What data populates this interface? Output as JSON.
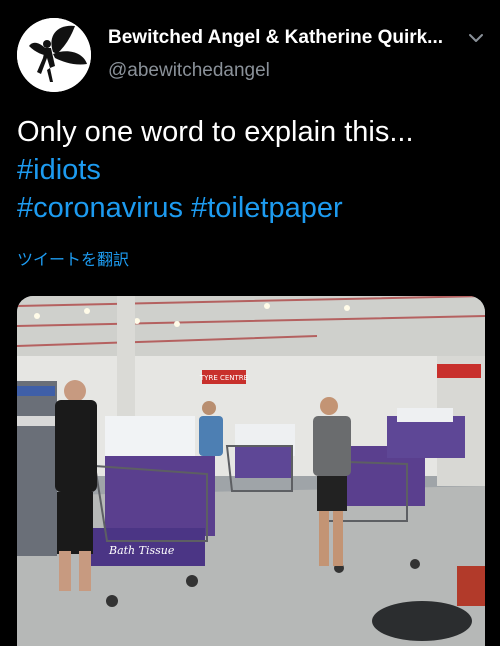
{
  "author": {
    "display_name": "Bewitched Angel & Katherine Quirk...",
    "handle": "@abewitchedangel",
    "avatar_icon": "fairy-silhouette-avatar"
  },
  "menu": {
    "icon": "chevron-down-icon"
  },
  "tweet": {
    "text_line1": "Only one word to explain this...",
    "hashtags": [
      "#idiots",
      "#coronavirus",
      "#toiletpaper"
    ]
  },
  "translate_label": "ツイートを翻訳",
  "media": {
    "store_sign": "TYRE CENTRE",
    "package_label": "Bath Tissue"
  },
  "colors": {
    "background": "#000000",
    "primary_text": "#ffffff",
    "secondary_text": "#8a9199",
    "link": "#1d9bf0"
  }
}
